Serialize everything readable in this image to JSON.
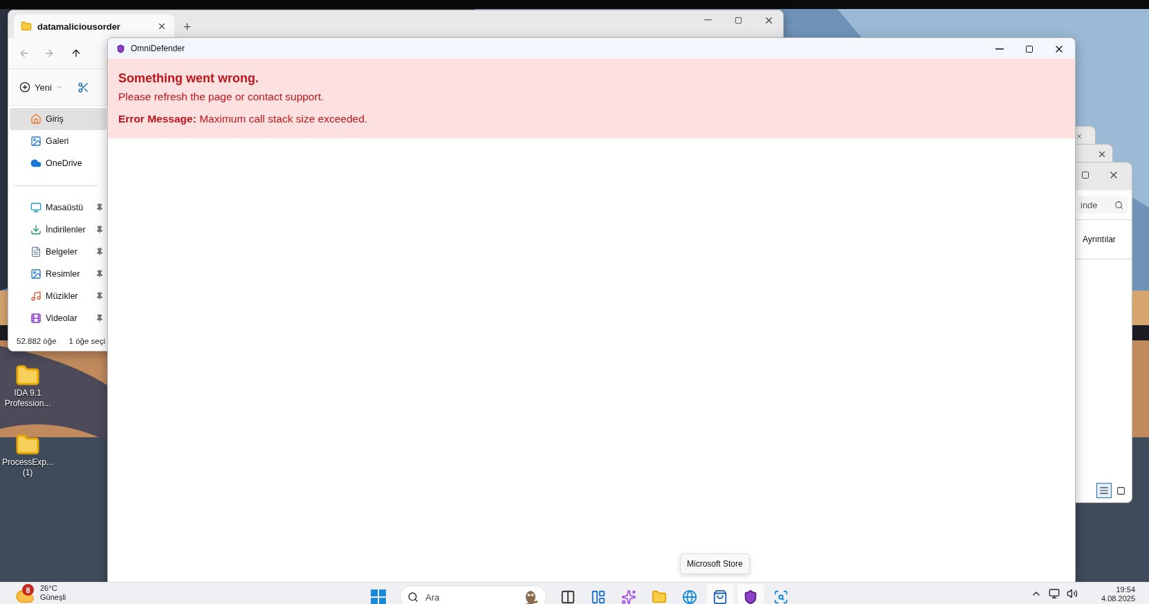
{
  "desktop_icons": [
    {
      "lines": [
        "IDA 9.1",
        "Profession..."
      ]
    },
    {
      "lines": [
        "ProcessExp...",
        "(1)"
      ]
    }
  ],
  "explorer": {
    "tab": {
      "title": "datamaliciousorder",
      "selected": true
    },
    "new_button": "Yeni",
    "sidebar": {
      "items": [
        {
          "kind": "home",
          "label": "Giriş",
          "selected": true,
          "pinned": false
        },
        {
          "kind": "gallery",
          "label": "Galeri",
          "selected": false,
          "pinned": false
        },
        {
          "kind": "onedrive",
          "label": "OneDrive",
          "selected": false,
          "pinned": false
        },
        {
          "kind": "divider"
        },
        {
          "kind": "desktop",
          "label": "Masaüstü",
          "selected": false,
          "pinned": true
        },
        {
          "kind": "downloads",
          "label": "İndirilenler",
          "selected": false,
          "pinned": true
        },
        {
          "kind": "documents",
          "label": "Belgeler",
          "selected": false,
          "pinned": true
        },
        {
          "kind": "pictures",
          "label": "Resimler",
          "selected": false,
          "pinned": true
        },
        {
          "kind": "music",
          "label": "Müzikler",
          "selected": false,
          "pinned": true
        },
        {
          "kind": "videos",
          "label": "Videolar",
          "selected": false,
          "pinned": true
        }
      ]
    },
    "status_bar": {
      "count": "52.882 öğe",
      "selection": "1 öğe seçi"
    }
  },
  "back_window": {
    "search": {
      "placeholder": "inde"
    },
    "view_button": "Ayrıntılar",
    "view_toggles": [
      {
        "kind": "details",
        "selected": true
      },
      {
        "kind": "tiles",
        "selected": false
      }
    ]
  },
  "app_window": {
    "title": "OmniDefender",
    "error": {
      "heading": "Something went wrong.",
      "hint": "Please refresh the page or contact support.",
      "label": "Error Message:",
      "message": "Maximum call stack size exceeded."
    }
  },
  "tooltip": "Microsoft Store",
  "taskbar": {
    "weather": {
      "badge": "8",
      "temperature": "26°C",
      "condition": "Güneşli"
    },
    "search": {
      "placeholder": "Ara"
    },
    "apps": [
      {
        "kind": "task-view",
        "active": false
      },
      {
        "kind": "widgets",
        "active": false
      },
      {
        "kind": "copilot",
        "active": false
      },
      {
        "kind": "explorer",
        "active": false
      },
      {
        "kind": "edge",
        "active": false
      },
      {
        "kind": "store",
        "active": true
      },
      {
        "kind": "shield",
        "active": true
      },
      {
        "kind": "magnifier",
        "active": false
      }
    ],
    "clock": {
      "time": "19:54",
      "date": "4.08.2025"
    }
  }
}
